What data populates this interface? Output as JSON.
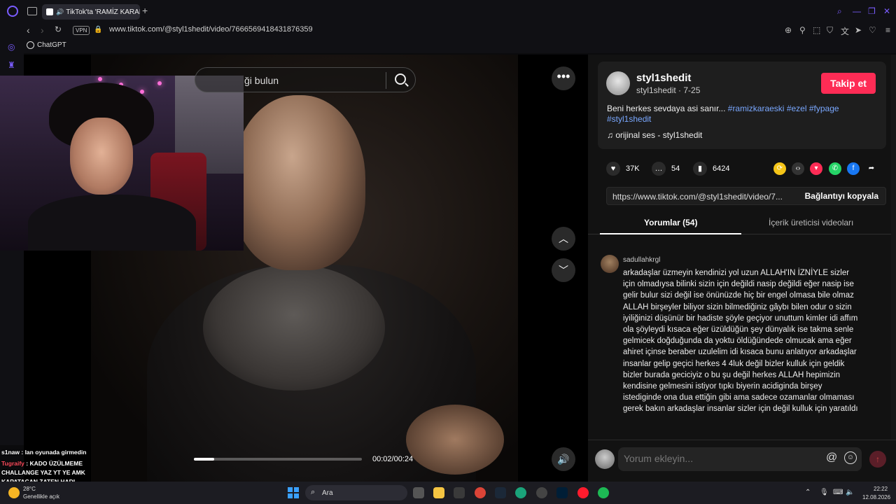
{
  "browser": {
    "tab_title": "TikTok'ta 'RAMİZ KARAI",
    "url": "www.tiktok.com/@styl1shedit/video/7666569418431876359",
    "vpn_label": "VPN",
    "bookmark": "ChatGPT"
  },
  "player": {
    "search_placeholder": "ği bulun",
    "time": "00:02/00:24",
    "progress": 0.12
  },
  "chat": [
    {
      "user": "s1naw",
      "sep": " : ",
      "text": "lan oyunada girmedin"
    },
    {
      "user": "Tugraify",
      "sep": " : ",
      "text": "KADO ÜZÜLMEME CHALLANGE YAZ YT YE AMK KAPATACAN ZATEN HADI"
    }
  ],
  "post": {
    "author": "styl1shedit",
    "author_sub": "styl1shedit · 7-25",
    "follow_label": "Takip et",
    "desc_text": "Beni herkes sevdaya asi sanır... ",
    "tags": [
      "#ramizkaraeski",
      "#ezel",
      "#fypage",
      "#styl1shedit"
    ],
    "music": "orijinal ses - styl1shedit",
    "likes": "37K",
    "comments": "54",
    "saves": "6424",
    "link": "https://www.tiktok.com/@styl1shedit/video/7...",
    "copy_label": "Bağlantıyı kopyala"
  },
  "tabs": {
    "comments": "Yorumlar (54)",
    "creator_videos": "İçerik üreticisi videoları"
  },
  "comment": {
    "user": "sadullahkrgl",
    "text": "arkadaşlar üzmeyin kendinizi yol uzun ALLAH'IN İZNİYLE sizler için olmadıysa bilinki sizin için değildi nasip değildi eğer nasip ise gelir bulur sizi değil ise önünüzde hiç bir engel olmasa bile olmaz ALLAH birşeyler biliyor sizin bilmediğiniz gâybı bilen odur o sizin iyiliğinizi düşünür bir hadiste şöyle geçiyor unuttum kimler idi affım ola şöyleydi kısaca eğer üzüldüğün şey dünyalık ise takma senle gelmicek doğduğunda da yoktu öldüğündede olmucak ama eğer ahiret içinse beraber uzulelim idi kısaca bunu anlatıyor arkadaşlar insanlar gelip geçici herkes 4 4luk değil bizler kulluk için geldik bizler burada geciciyiz o bu şu değil herkes ALLAH hepimizin kendisine gelmesini istiyor tıpkı biyerin acidiginda birşey istediginde ona dua ettiğin gibi ama sadece ozamanlar olmaması gerek bakın arkadaşlar insanlar sizler için değil kulluk için yaratıldı"
  },
  "comment_input": {
    "placeholder": "Yorum ekleyin...",
    "at": "@"
  },
  "taskbar": {
    "search": "Ara",
    "temp": "28°C",
    "weather": "Genellikle açık",
    "time": "22:22",
    "date": "12.08.2026"
  },
  "colors": {
    "accent": "#fe2c55",
    "tag": "#7aa8ff",
    "browser_accent": "#7a5cff"
  }
}
